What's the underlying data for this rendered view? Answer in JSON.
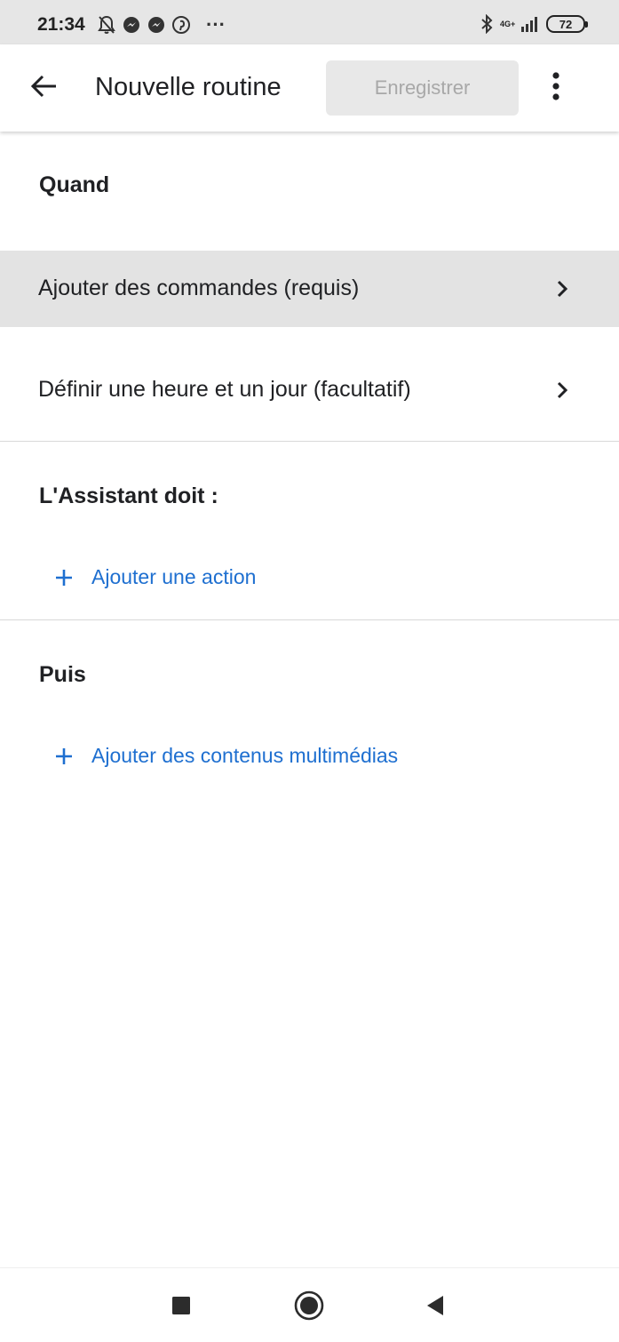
{
  "status_bar": {
    "time": "21:34",
    "left_icons": [
      "bell-off-icon",
      "messenger-icon",
      "messenger-icon",
      "pinterest-icon",
      "more-dots-icon"
    ],
    "more_dots": "···",
    "network_label": "4G+",
    "battery_level": "72"
  },
  "app_bar": {
    "title": "Nouvelle routine",
    "save_label": "Enregistrer"
  },
  "sections": {
    "when": {
      "title": "Quand",
      "items": [
        {
          "label": "Ajouter des commandes (requis)",
          "highlighted": true
        },
        {
          "label": "Définir une heure et un jour (facultatif)",
          "highlighted": false
        }
      ]
    },
    "assistant": {
      "title": "L'Assistant doit :",
      "add_label": "Ajouter une action"
    },
    "then": {
      "title": "Puis",
      "add_label": "Ajouter des contenus multimédias"
    }
  },
  "colors": {
    "accent": "#1e6fd0",
    "status_bar_bg": "#e6e6e6",
    "highlight_row": "#e3e3e3",
    "disabled_button_bg": "#e8e8e8",
    "disabled_button_text": "#a8a8a8"
  },
  "nav_bar": {
    "icons": [
      "recents-square-icon",
      "home-circle-icon",
      "back-triangle-icon"
    ]
  }
}
